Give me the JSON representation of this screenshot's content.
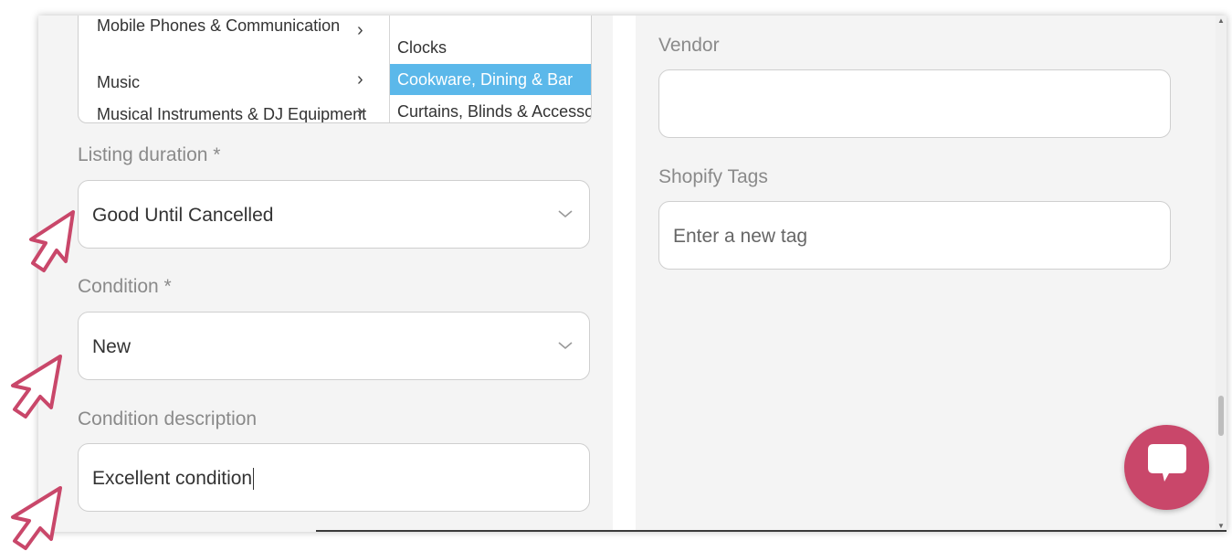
{
  "categories": {
    "column1": [
      {
        "label": "Mobile Phones & Communication"
      },
      {
        "label": "Music"
      },
      {
        "label": "Musical Instruments & DJ Equipment"
      }
    ],
    "column2": [
      {
        "label": "Clocks",
        "selected": false
      },
      {
        "label": "Cookware, Dining & Bar",
        "selected": true
      },
      {
        "label": "Curtains, Blinds & Accessories",
        "selected": false
      }
    ],
    "chevron_icon": "chevron-right-icon"
  },
  "listing_duration": {
    "label": "Listing duration *",
    "value": "Good Until Cancelled"
  },
  "condition": {
    "label": "Condition *",
    "value": "New"
  },
  "condition_description": {
    "label": "Condition description",
    "value": "Excellent condition"
  },
  "vendor": {
    "label": "Vendor",
    "value": ""
  },
  "shopify_tags": {
    "label": "Shopify Tags",
    "placeholder": "Enter a new tag"
  },
  "chat": {
    "icon": "chat-bubble-icon"
  },
  "colors": {
    "accent": "#c9476a",
    "selection": "#5bb8ea"
  }
}
